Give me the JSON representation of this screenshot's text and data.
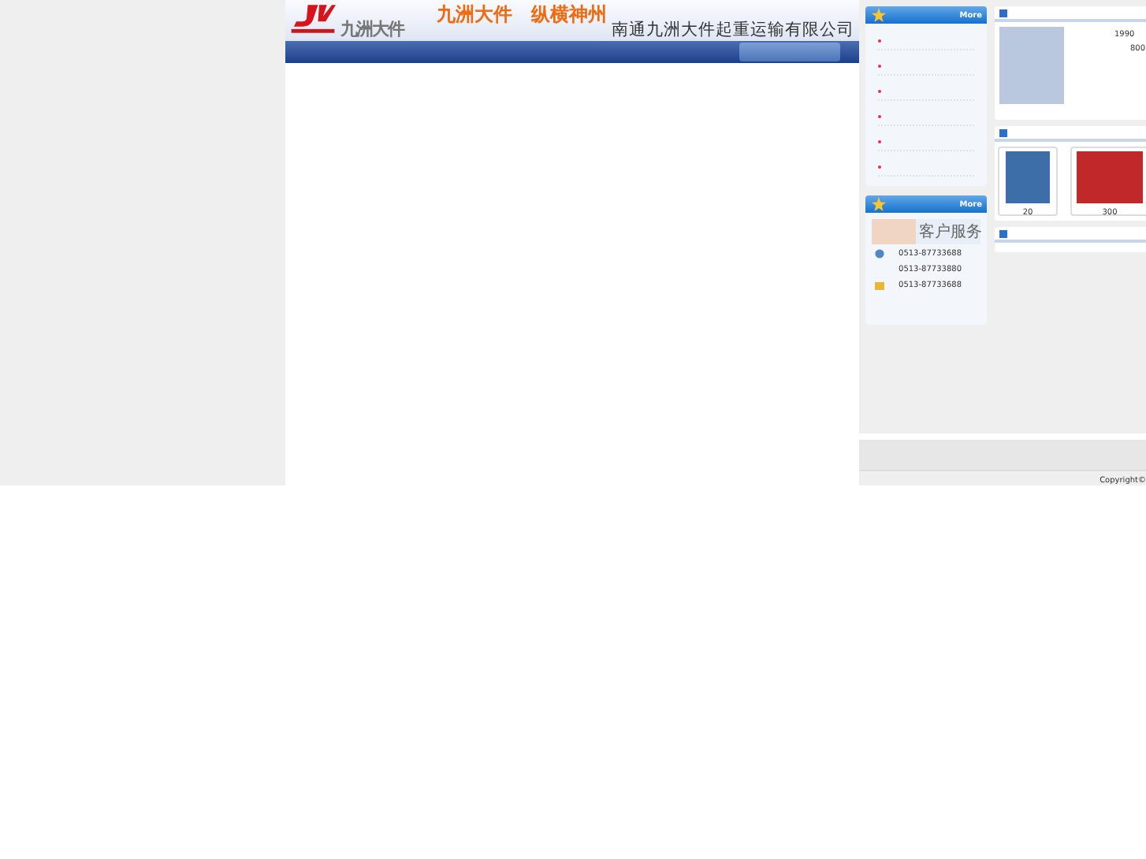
{
  "header": {
    "logo_text": "九洲大件",
    "slogan": "九洲大件　纵横神州",
    "company": "南通九洲大件起重运输有限公司"
  },
  "news_panel": {
    "more": "More"
  },
  "contact_panel": {
    "more": "More",
    "title": "客户服务",
    "phones": [
      {
        "kind": "phone",
        "number": "0513-87733688"
      },
      {
        "kind": "plain",
        "number": "0513-87733880"
      },
      {
        "kind": "mail",
        "number": "0513-87733688"
      }
    ]
  },
  "about_panel": {
    "figures": [
      "1990",
      "800"
    ]
  },
  "products_panel": {
    "captions": [
      "20",
      "300"
    ]
  },
  "footer": {
    "copyright": "Copyright©"
  }
}
